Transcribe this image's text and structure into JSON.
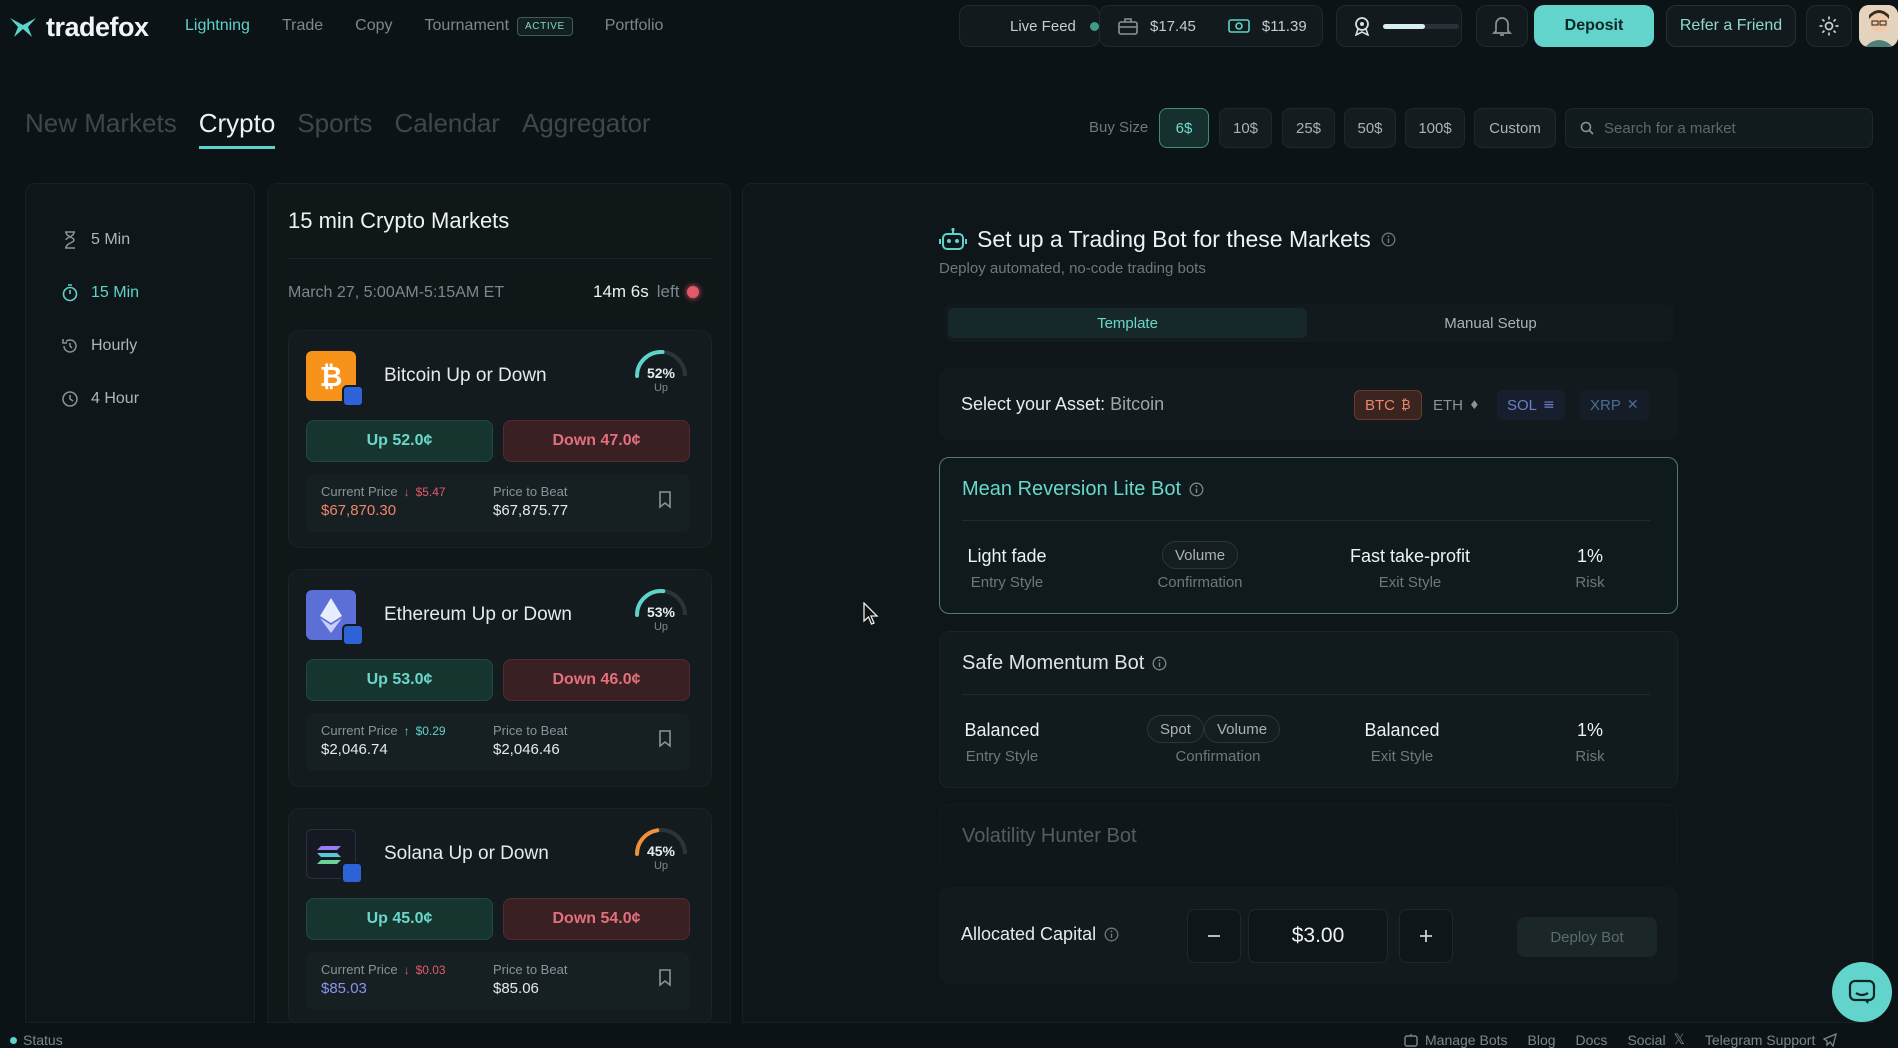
{
  "app": {
    "name": "tradefox",
    "nav": [
      {
        "label": "Lightning",
        "active": true
      },
      {
        "label": "Trade"
      },
      {
        "label": "Copy"
      },
      {
        "label": "Tournament",
        "badge": "ACTIVE"
      },
      {
        "label": "Portfolio"
      }
    ],
    "live_feed": "Live Feed",
    "balance_wallet": "$17.45",
    "balance_cash": "$11.39",
    "deposit": "Deposit",
    "refer": "Refer a Friend"
  },
  "categories": {
    "tabs": [
      "New Markets",
      "Crypto",
      "Sports",
      "Calendar",
      "Aggregator"
    ],
    "selected": "Crypto"
  },
  "buy_size": {
    "label": "Buy Size",
    "options": [
      "6$",
      "10$",
      "25$",
      "50$",
      "100$",
      "Custom"
    ],
    "selected": "6$"
  },
  "search": {
    "placeholder": "Search for a market"
  },
  "durations": [
    {
      "label": "5 Min",
      "icon": "hourglass-icon"
    },
    {
      "label": "15 Min",
      "icon": "stopwatch-icon",
      "selected": true
    },
    {
      "label": "Hourly",
      "icon": "history-icon"
    },
    {
      "label": "4 Hour",
      "icon": "clock-icon"
    }
  ],
  "markets": {
    "title": "15 min Crypto Markets",
    "date": "March 27, 5:00AM-5:15AM ET",
    "time_left": "14m 6s",
    "left_label": "left",
    "current_price_label": "Current Price",
    "price_to_beat_label": "Price to Beat",
    "cards": [
      {
        "name": "Bitcoin Up or Down",
        "pct": "52%",
        "pct_value": 52,
        "gauge_sub": "Up",
        "up": "Up 52.0¢",
        "down": "Down 47.0¢",
        "change": "$5.47",
        "change_dir": "down",
        "current": "$67,870.30",
        "current_color": "#f0856a",
        "beat": "$67,875.77",
        "coin": "btc",
        "color": "#f7931a"
      },
      {
        "name": "Ethereum Up or Down",
        "pct": "53%",
        "pct_value": 53,
        "gauge_sub": "Up",
        "up": "Up 53.0¢",
        "down": "Down 46.0¢",
        "change": "$0.29",
        "change_dir": "up",
        "current": "$2,046.74",
        "current_color": "#e6eaeb",
        "beat": "$2,046.46",
        "coin": "eth",
        "color": "#6c7fe0"
      },
      {
        "name": "Solana Up or Down",
        "pct": "45%",
        "pct_value": 45,
        "gauge_sub": "Up",
        "up": "Up 45.0¢",
        "down": "Down 54.0¢",
        "change": "$0.03",
        "change_dir": "down",
        "current": "$85.03",
        "current_color": "#8c93f0",
        "beat": "$85.06",
        "coin": "sol",
        "color": "#1b1f2a"
      }
    ]
  },
  "bot": {
    "title": "Set up a Trading Bot for these Markets",
    "subtitle": "Deploy automated, no-code trading bots",
    "tabs": [
      "Template",
      "Manual Setup"
    ],
    "selected_tab": "Template",
    "asset_label": "Select your Asset:",
    "asset_value": "Bitcoin",
    "assets": [
      {
        "label": "BTC",
        "glyph": "₿",
        "color": "#f0856a",
        "bg": "#3a2420",
        "border": "#6b3a2c"
      },
      {
        "label": "ETH",
        "glyph": "♦",
        "color": "#8a9396",
        "bg": "transparent",
        "border": "transparent"
      },
      {
        "label": "SOL",
        "glyph": "≡",
        "color": "#6f7fc9",
        "bg": "#171f2e",
        "border": "transparent"
      },
      {
        "label": "XRP",
        "glyph": "✕",
        "color": "#4f6c8e",
        "bg": "#151e28",
        "border": "transparent"
      }
    ],
    "templates": [
      {
        "name": "Mean Reversion Lite Bot",
        "entry": "Light fade",
        "confirm": [
          "Volume"
        ],
        "exit": "Fast take-profit",
        "risk": "1%",
        "selected": true
      },
      {
        "name": "Safe Momentum Bot",
        "entry": "Balanced",
        "confirm": [
          "Spot",
          "Volume"
        ],
        "exit": "Balanced",
        "risk": "1%"
      },
      {
        "name": "Volatility Hunter Bot"
      }
    ],
    "labels": {
      "entry": "Entry Style",
      "confirm": "Confirmation",
      "exit": "Exit Style",
      "risk": "Risk"
    },
    "alloc_label": "Allocated Capital",
    "alloc_value": "$3.00",
    "deploy": "Deploy Bot"
  },
  "footer": {
    "status": "Status",
    "links": [
      "Manage Bots",
      "Blog",
      "Docs",
      "Social",
      "Telegram Support"
    ]
  }
}
